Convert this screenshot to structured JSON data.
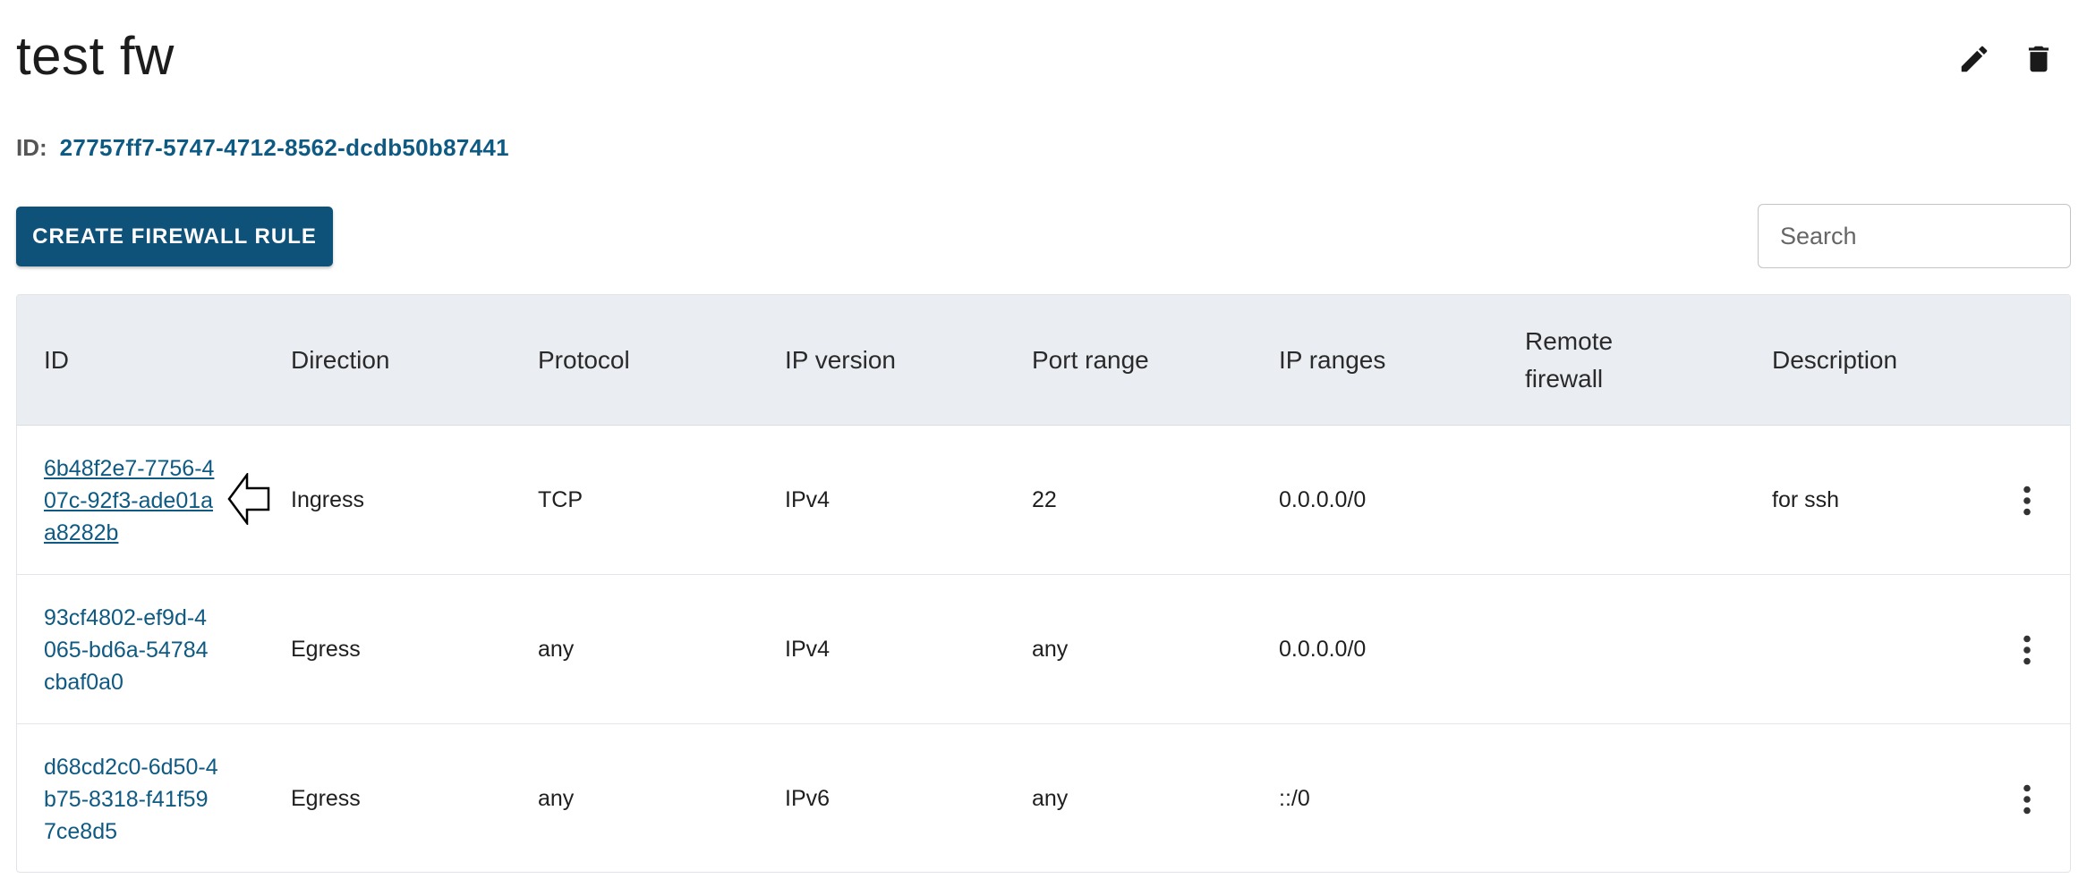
{
  "header": {
    "title": "test fw",
    "edit_icon": "pencil-icon",
    "delete_icon": "trash-icon"
  },
  "firewall_id": {
    "label": "ID:",
    "value": "27757ff7-5747-4712-8562-dcdb50b87441"
  },
  "toolbar": {
    "create_label": "CREATE FIREWALL RULE",
    "search_placeholder": "Search",
    "search_value": ""
  },
  "table": {
    "columns": [
      "ID",
      "Direction",
      "Protocol",
      "IP version",
      "Port range",
      "IP ranges",
      "Remote firewall",
      "Description"
    ],
    "rows": [
      {
        "id": "6b48f2e7-7756-407c-92f3-ade01aa8282b",
        "direction": "Ingress",
        "protocol": "TCP",
        "ip_version": "IPv4",
        "port_range": "22",
        "ip_ranges": "0.0.0.0/0",
        "remote_firewall": "",
        "description": "for ssh"
      },
      {
        "id": "93cf4802-ef9d-4065-bd6a-54784cbaf0a0",
        "direction": "Egress",
        "protocol": "any",
        "ip_version": "IPv4",
        "port_range": "any",
        "ip_ranges": "0.0.0.0/0",
        "remote_firewall": "",
        "description": ""
      },
      {
        "id": "d68cd2c0-6d50-4b75-8318-f41f597ce8d5",
        "direction": "Egress",
        "protocol": "any",
        "ip_version": "IPv6",
        "port_range": "any",
        "ip_ranges": "::/0",
        "remote_firewall": "",
        "description": ""
      }
    ]
  },
  "colors": {
    "primary": "#0e5179",
    "link": "#0e5a82",
    "header_bg": "#eaeef2"
  }
}
